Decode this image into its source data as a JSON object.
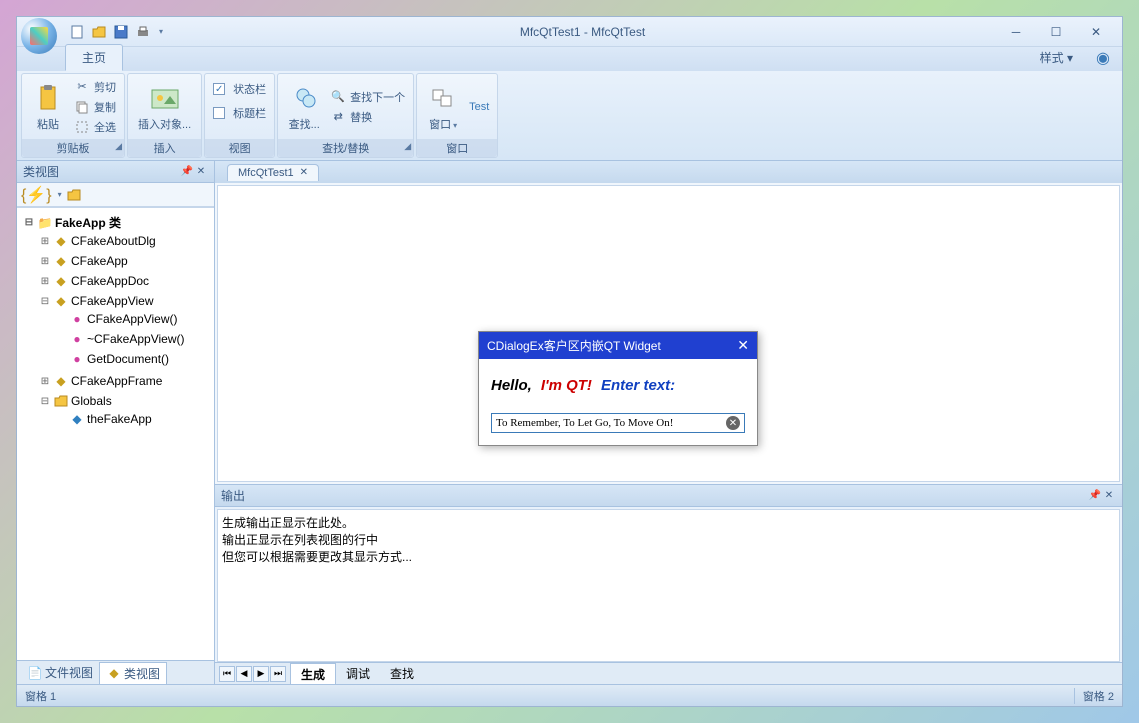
{
  "title": "MfcQtTest1 - MfcQtTest",
  "tabs": {
    "home": "主页",
    "style": "样式"
  },
  "ribbon": {
    "clipboard": {
      "label": "剪贴板",
      "paste": "粘贴",
      "cut": "剪切",
      "copy": "复制",
      "selectAll": "全选"
    },
    "insert": {
      "label": "插入",
      "insertObj": "插入对象..."
    },
    "view": {
      "label": "视图",
      "statusBar": "状态栏",
      "titleBar": "标题栏"
    },
    "find": {
      "label": "查找/替换",
      "findBtn": "查找...",
      "findNext": "查找下一个",
      "replace": "替换"
    },
    "window": {
      "label": "窗口",
      "windowBtn": "窗口",
      "test": "Test"
    }
  },
  "classView": {
    "title": "类视图",
    "root": "FakeApp 类",
    "nodes": {
      "aboutDlg": "CFakeAboutDlg",
      "app": "CFakeApp",
      "appDoc": "CFakeAppDoc",
      "appView": "CFakeAppView",
      "appViewCtor": "CFakeAppView()",
      "appViewDtor": "~CFakeAppView()",
      "getDoc": "GetDocument()",
      "appFrame": "CFakeAppFrame",
      "globals": "Globals",
      "theFakeApp": "theFakeApp"
    },
    "tabs": {
      "fileView": "文件视图",
      "classView": "类视图"
    }
  },
  "docTab": "MfcQtTest1",
  "dialog": {
    "title": "CDialogEx客户区内嵌QT Widget",
    "hello": "Hello,",
    "imqt": "I'm QT!",
    "enter": "Enter text:",
    "inputValue": "To Remember, To Let Go, To Move On!"
  },
  "output": {
    "title": "输出",
    "line1": "生成输出正显示在此处。",
    "line2": "输出正显示在列表视图的行中",
    "line3": "但您可以根据需要更改其显示方式...",
    "tabs": {
      "build": "生成",
      "debug": "调试",
      "find": "查找"
    }
  },
  "status": {
    "left": "窗格 1",
    "right": "窗格 2"
  }
}
